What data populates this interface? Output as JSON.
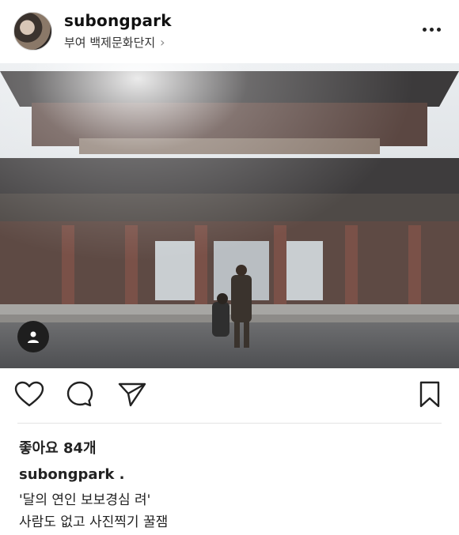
{
  "post": {
    "username": "subongpark",
    "location": "부여 백제문화단지",
    "likes_text": "좋아요 84개",
    "caption_username": "subongpark .",
    "caption_lines": [
      "'달의 연인 보보경심 려'",
      "사람도 없고 사진찍기 꿀잼"
    ]
  },
  "icons": {
    "more": "more-options-icon",
    "location_chevron": "chevron-right-icon",
    "tag": "person-tag-icon",
    "like": "heart-icon",
    "comment": "comment-icon",
    "share": "send-icon",
    "save": "bookmark-icon"
  }
}
